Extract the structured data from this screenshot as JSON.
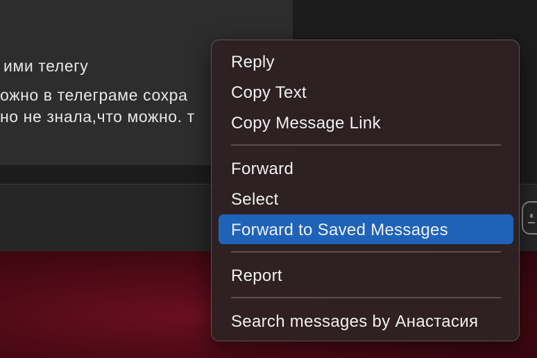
{
  "chat": {
    "message_lines": [
      "ими телегу",
      "ожно в телеграме сохра",
      "но не знала,что можно. т"
    ]
  },
  "context_menu": {
    "items": [
      "Reply",
      "Copy Text",
      "Copy Message Link",
      "Forward",
      "Select",
      "Forward to Saved Messages",
      "Report",
      "Search messages by Анастасия"
    ],
    "highlighted_item": "Forward to Saved Messages",
    "highlight_color": "#1f63b9"
  },
  "composer": {
    "icon": "emoji-icon"
  }
}
